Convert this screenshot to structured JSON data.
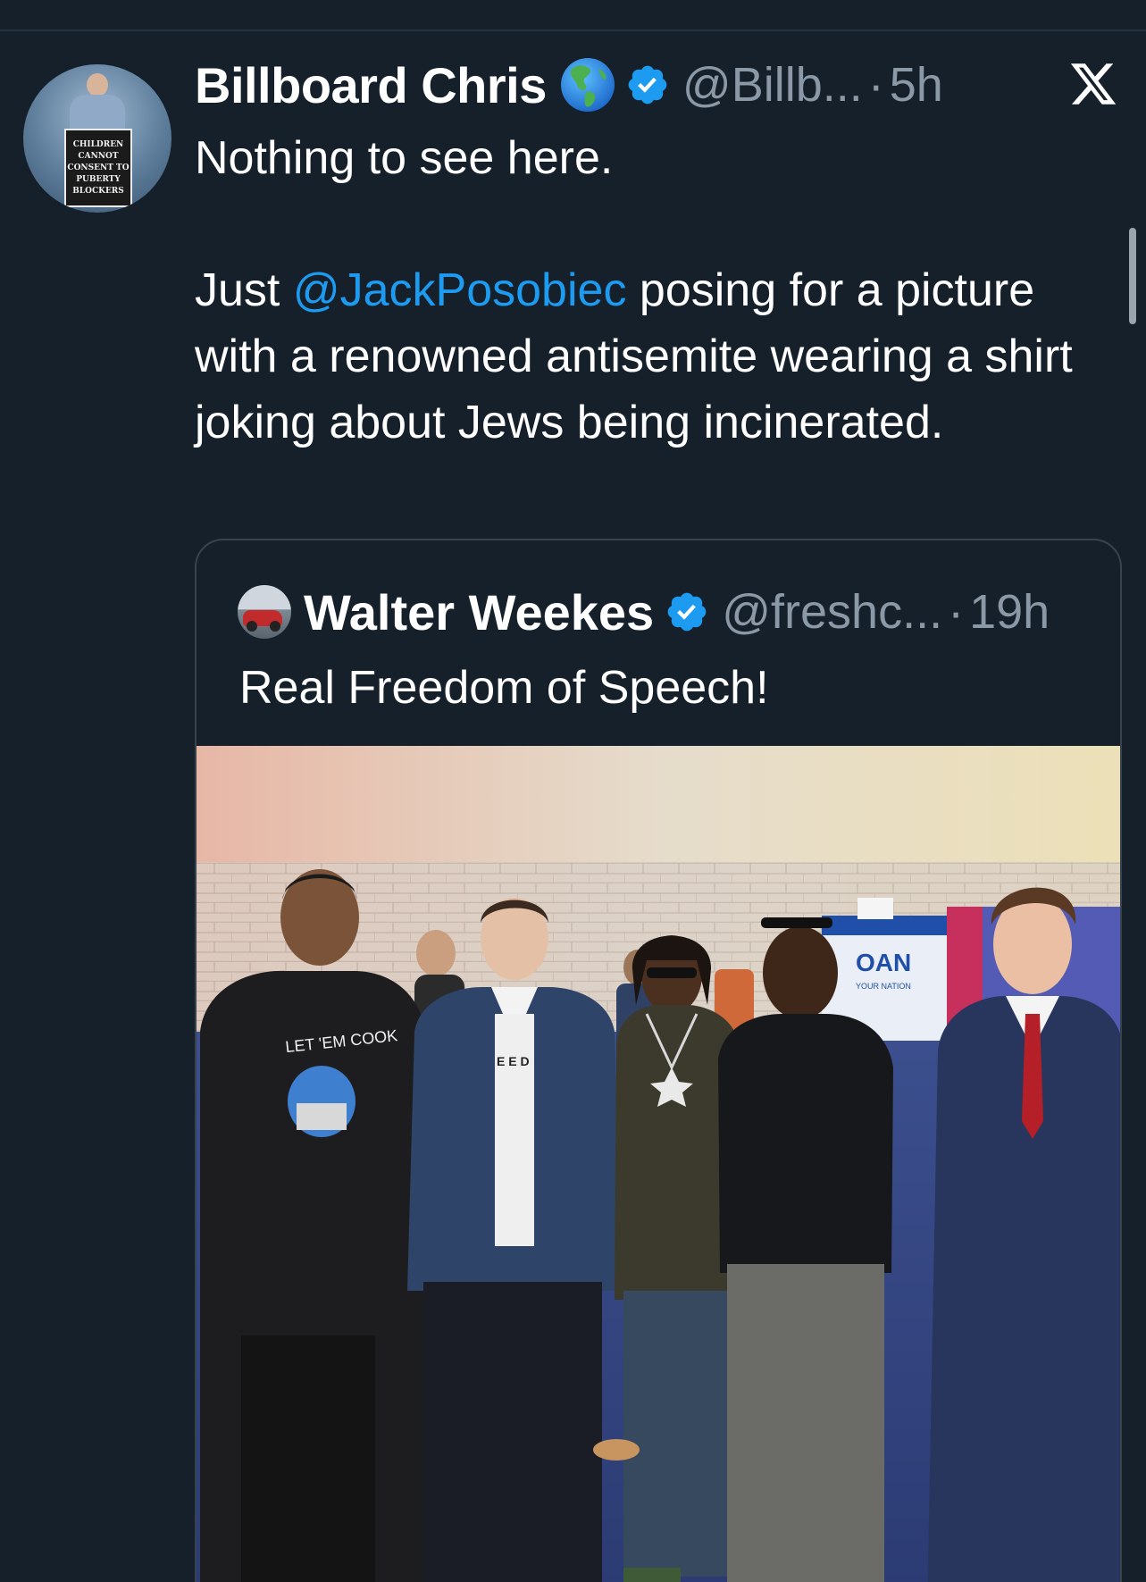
{
  "tweet": {
    "author": {
      "display_name": "Billboard Chris",
      "name_emoji": "globe-americas-icon",
      "handle": "@Billb...",
      "time": "5h",
      "avatar_sign_text": "CHILDREN\nCANNOT\nCONSENT TO\nPUBERTY\nBLOCKERS"
    },
    "separator": "·",
    "text": {
      "line1": "Nothing to see here.",
      "para2_before": "Just ",
      "mention": "@JackPosobiec",
      "para2_after": " posing for a picture with a renowned antisemite wearing a shirt joking about Jews being incinerated."
    }
  },
  "quoted_tweet": {
    "display_name": "Walter Weekes",
    "handle": "@freshc...",
    "time": "19h",
    "text": "Real Freedom of Speech!",
    "photo": {
      "shirt_text": "LET 'EM COOK",
      "booth_text": "OAN",
      "booth_sub": "YOUR NATION",
      "shirt2_text": "E E D"
    }
  },
  "colors": {
    "background": "#15202b",
    "accent": "#1d9bf0",
    "secondary_text": "#8b98a5",
    "border": "#38444d"
  },
  "icons": {
    "close": "x-logo-icon",
    "verified": "verified-badge-icon"
  }
}
